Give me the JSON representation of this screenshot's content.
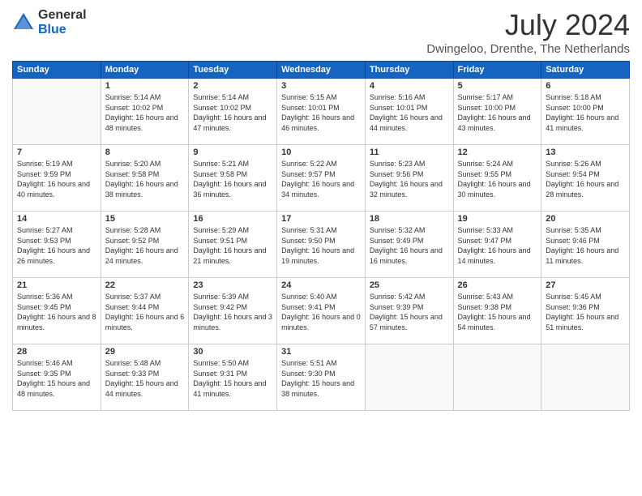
{
  "logo": {
    "general": "General",
    "blue": "Blue"
  },
  "header": {
    "month_year": "July 2024",
    "location": "Dwingeloo, Drenthe, The Netherlands"
  },
  "weekdays": [
    "Sunday",
    "Monday",
    "Tuesday",
    "Wednesday",
    "Thursday",
    "Friday",
    "Saturday"
  ],
  "weeks": [
    [
      {
        "day": "",
        "sunrise": "",
        "sunset": "",
        "daylight": "",
        "empty": true
      },
      {
        "day": "1",
        "sunrise": "5:14 AM",
        "sunset": "10:02 PM",
        "daylight": "16 hours and 48 minutes."
      },
      {
        "day": "2",
        "sunrise": "5:14 AM",
        "sunset": "10:02 PM",
        "daylight": "16 hours and 47 minutes."
      },
      {
        "day": "3",
        "sunrise": "5:15 AM",
        "sunset": "10:01 PM",
        "daylight": "16 hours and 46 minutes."
      },
      {
        "day": "4",
        "sunrise": "5:16 AM",
        "sunset": "10:01 PM",
        "daylight": "16 hours and 44 minutes."
      },
      {
        "day": "5",
        "sunrise": "5:17 AM",
        "sunset": "10:00 PM",
        "daylight": "16 hours and 43 minutes."
      },
      {
        "day": "6",
        "sunrise": "5:18 AM",
        "sunset": "10:00 PM",
        "daylight": "16 hours and 41 minutes."
      }
    ],
    [
      {
        "day": "7",
        "sunrise": "5:19 AM",
        "sunset": "9:59 PM",
        "daylight": "16 hours and 40 minutes."
      },
      {
        "day": "8",
        "sunrise": "5:20 AM",
        "sunset": "9:58 PM",
        "daylight": "16 hours and 38 minutes."
      },
      {
        "day": "9",
        "sunrise": "5:21 AM",
        "sunset": "9:58 PM",
        "daylight": "16 hours and 36 minutes."
      },
      {
        "day": "10",
        "sunrise": "5:22 AM",
        "sunset": "9:57 PM",
        "daylight": "16 hours and 34 minutes."
      },
      {
        "day": "11",
        "sunrise": "5:23 AM",
        "sunset": "9:56 PM",
        "daylight": "16 hours and 32 minutes."
      },
      {
        "day": "12",
        "sunrise": "5:24 AM",
        "sunset": "9:55 PM",
        "daylight": "16 hours and 30 minutes."
      },
      {
        "day": "13",
        "sunrise": "5:26 AM",
        "sunset": "9:54 PM",
        "daylight": "16 hours and 28 minutes."
      }
    ],
    [
      {
        "day": "14",
        "sunrise": "5:27 AM",
        "sunset": "9:53 PM",
        "daylight": "16 hours and 26 minutes."
      },
      {
        "day": "15",
        "sunrise": "5:28 AM",
        "sunset": "9:52 PM",
        "daylight": "16 hours and 24 minutes."
      },
      {
        "day": "16",
        "sunrise": "5:29 AM",
        "sunset": "9:51 PM",
        "daylight": "16 hours and 21 minutes."
      },
      {
        "day": "17",
        "sunrise": "5:31 AM",
        "sunset": "9:50 PM",
        "daylight": "16 hours and 19 minutes."
      },
      {
        "day": "18",
        "sunrise": "5:32 AM",
        "sunset": "9:49 PM",
        "daylight": "16 hours and 16 minutes."
      },
      {
        "day": "19",
        "sunrise": "5:33 AM",
        "sunset": "9:47 PM",
        "daylight": "16 hours and 14 minutes."
      },
      {
        "day": "20",
        "sunrise": "5:35 AM",
        "sunset": "9:46 PM",
        "daylight": "16 hours and 11 minutes."
      }
    ],
    [
      {
        "day": "21",
        "sunrise": "5:36 AM",
        "sunset": "9:45 PM",
        "daylight": "16 hours and 8 minutes."
      },
      {
        "day": "22",
        "sunrise": "5:37 AM",
        "sunset": "9:44 PM",
        "daylight": "16 hours and 6 minutes."
      },
      {
        "day": "23",
        "sunrise": "5:39 AM",
        "sunset": "9:42 PM",
        "daylight": "16 hours and 3 minutes."
      },
      {
        "day": "24",
        "sunrise": "5:40 AM",
        "sunset": "9:41 PM",
        "daylight": "16 hours and 0 minutes."
      },
      {
        "day": "25",
        "sunrise": "5:42 AM",
        "sunset": "9:39 PM",
        "daylight": "15 hours and 57 minutes."
      },
      {
        "day": "26",
        "sunrise": "5:43 AM",
        "sunset": "9:38 PM",
        "daylight": "15 hours and 54 minutes."
      },
      {
        "day": "27",
        "sunrise": "5:45 AM",
        "sunset": "9:36 PM",
        "daylight": "15 hours and 51 minutes."
      }
    ],
    [
      {
        "day": "28",
        "sunrise": "5:46 AM",
        "sunset": "9:35 PM",
        "daylight": "15 hours and 48 minutes."
      },
      {
        "day": "29",
        "sunrise": "5:48 AM",
        "sunset": "9:33 PM",
        "daylight": "15 hours and 44 minutes."
      },
      {
        "day": "30",
        "sunrise": "5:50 AM",
        "sunset": "9:31 PM",
        "daylight": "15 hours and 41 minutes."
      },
      {
        "day": "31",
        "sunrise": "5:51 AM",
        "sunset": "9:30 PM",
        "daylight": "15 hours and 38 minutes."
      },
      {
        "day": "",
        "sunrise": "",
        "sunset": "",
        "daylight": "",
        "empty": true
      },
      {
        "day": "",
        "sunrise": "",
        "sunset": "",
        "daylight": "",
        "empty": true
      },
      {
        "day": "",
        "sunrise": "",
        "sunset": "",
        "daylight": "",
        "empty": true
      }
    ]
  ]
}
